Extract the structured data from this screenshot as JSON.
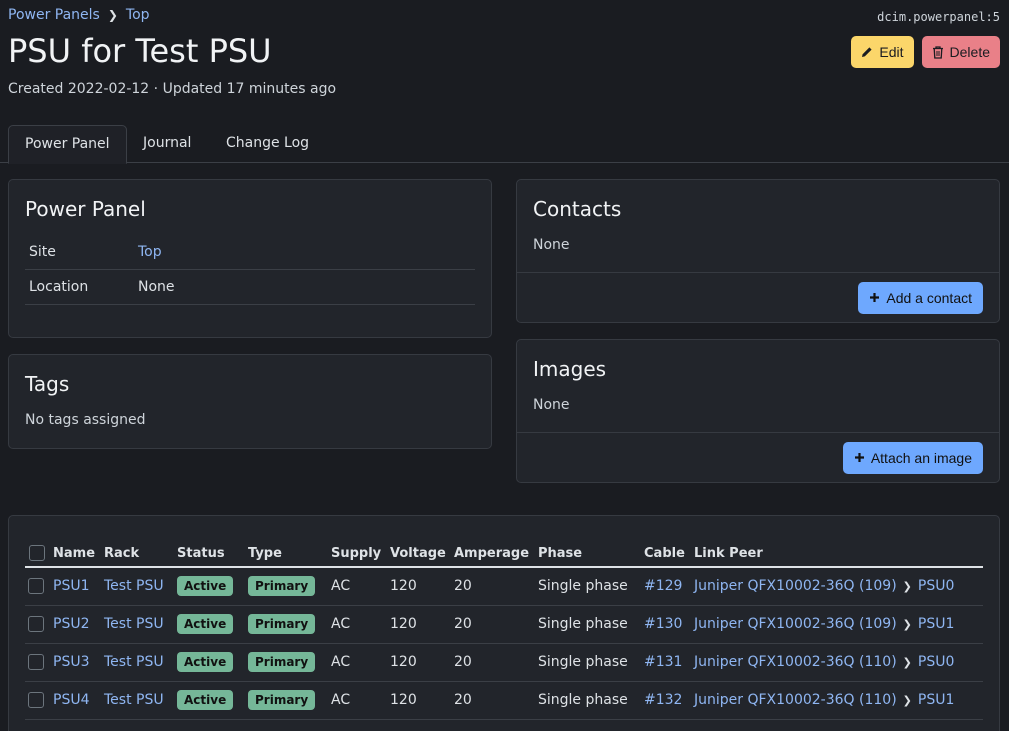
{
  "breadcrumb": {
    "parent": "Power Panels",
    "current": "Top"
  },
  "object_id": "dcim.powerpanel:5",
  "title": "PSU for Test PSU",
  "meta": "Created 2022-02-12 · Updated 17 minutes ago",
  "actions": {
    "edit": "Edit",
    "delete": "Delete"
  },
  "tabs": [
    "Power Panel",
    "Journal",
    "Change Log"
  ],
  "power_panel": {
    "heading": "Power Panel",
    "site_label": "Site",
    "site_value": "Top",
    "location_label": "Location",
    "location_value": "None"
  },
  "tags": {
    "heading": "Tags",
    "empty": "No tags assigned"
  },
  "contacts": {
    "heading": "Contacts",
    "empty": "None",
    "button": "Add a contact"
  },
  "images": {
    "heading": "Images",
    "empty": "None",
    "button": "Attach an image"
  },
  "table": {
    "headers": [
      "Name",
      "Rack",
      "Status",
      "Type",
      "Supply",
      "Voltage",
      "Amperage",
      "Phase",
      "Cable",
      "Link Peer"
    ],
    "rows": [
      {
        "name": "PSU1",
        "rack": "Test PSU",
        "status": "Active",
        "type": "Primary",
        "supply": "AC",
        "voltage": "120",
        "amperage": "20",
        "phase": "Single phase",
        "cable": "#129",
        "peer_device": "Juniper QFX10002-36Q (109)",
        "peer_port": "PSU0"
      },
      {
        "name": "PSU2",
        "rack": "Test PSU",
        "status": "Active",
        "type": "Primary",
        "supply": "AC",
        "voltage": "120",
        "amperage": "20",
        "phase": "Single phase",
        "cable": "#130",
        "peer_device": "Juniper QFX10002-36Q (109)",
        "peer_port": "PSU1"
      },
      {
        "name": "PSU3",
        "rack": "Test PSU",
        "status": "Active",
        "type": "Primary",
        "supply": "AC",
        "voltage": "120",
        "amperage": "20",
        "phase": "Single phase",
        "cable": "#131",
        "peer_device": "Juniper QFX10002-36Q (110)",
        "peer_port": "PSU0"
      },
      {
        "name": "PSU4",
        "rack": "Test PSU",
        "status": "Active",
        "type": "Primary",
        "supply": "AC",
        "voltage": "120",
        "amperage": "20",
        "phase": "Single phase",
        "cable": "#132",
        "peer_device": "Juniper QFX10002-36Q (110)",
        "peer_port": "PSU1"
      }
    ]
  },
  "colors": {
    "background": "#1a1c21",
    "link": "#8fb6f2",
    "edit": "#fbd66a",
    "delete": "#e98088",
    "primary": "#6ea8fe",
    "success": "#75b798"
  },
  "icons": {
    "edit": "pencil-icon",
    "delete": "trash-icon",
    "add": "plus-icon",
    "breadcrumb_separator": "chevron-right-icon"
  }
}
